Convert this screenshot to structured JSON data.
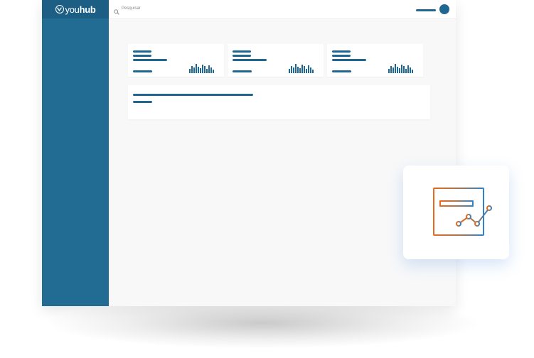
{
  "brand": {
    "logo_you": "you",
    "logo_hub": "hub"
  },
  "search": {
    "placeholder": "Pesquisar"
  },
  "icons": {
    "search": "search-icon",
    "logo": "youhub-logo-icon",
    "avatar": "user-avatar",
    "feature": "analytics-report-icon"
  },
  "colors": {
    "sidebar": "#226b93",
    "logo_bar": "#1d5f84",
    "accent": "#1f6690",
    "feature_gradient_start": "#e86a1e",
    "feature_gradient_end": "#2f82c8"
  },
  "stat_cards": [
    {
      "chart_heights": [
        6,
        10,
        8,
        13,
        9,
        7,
        12,
        10,
        6,
        11,
        8,
        5
      ]
    },
    {
      "chart_heights": [
        6,
        10,
        8,
        13,
        9,
        7,
        12,
        10,
        6,
        11,
        8,
        5
      ]
    },
    {
      "chart_heights": [
        6,
        10,
        8,
        13,
        9,
        7,
        12,
        10,
        6,
        11,
        8,
        5
      ]
    }
  ]
}
